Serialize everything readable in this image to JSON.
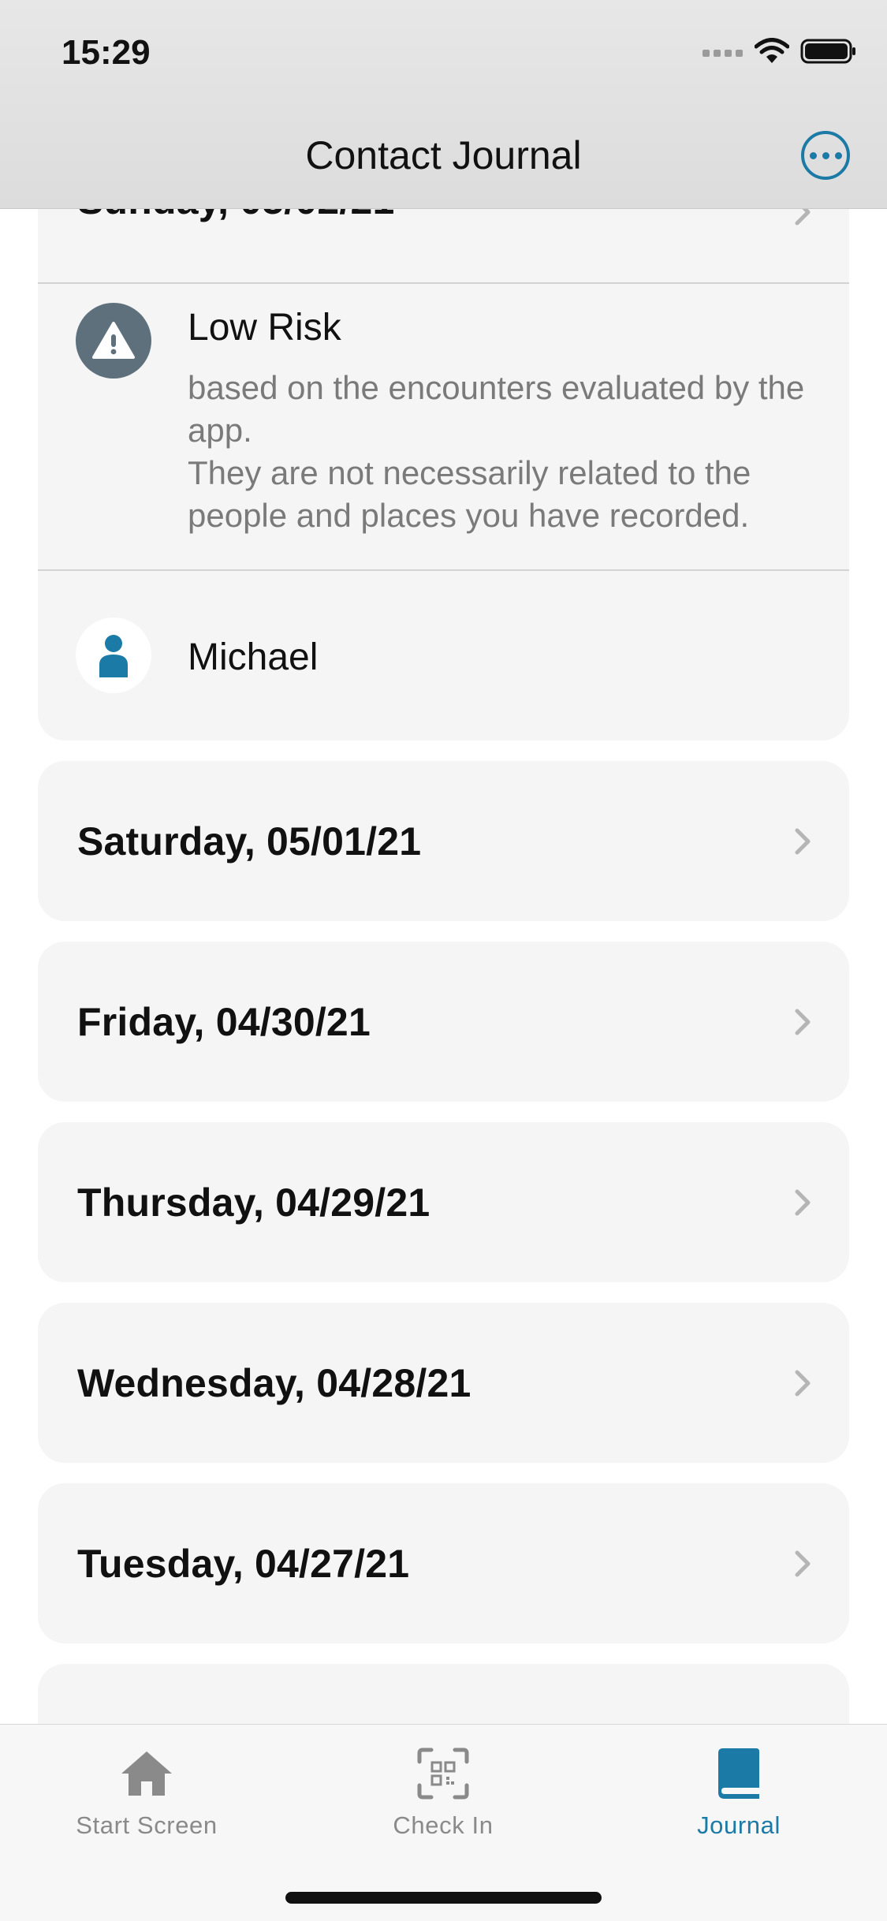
{
  "status_bar": {
    "time": "15:29"
  },
  "navigation": {
    "title": "Contact Journal",
    "more_icon": "ellipsis-circle-icon"
  },
  "colors": {
    "accent": "#1b7aa6",
    "risk_icon_bg": "#5f707d",
    "card_bg": "#f5f5f5"
  },
  "expanded_day": {
    "title": "Sunday, 05/02/21",
    "risk": {
      "icon": "warning-triangle-icon",
      "title": "Low Risk",
      "description_line1": "based on the encounters evaluated by the app.",
      "description_line2": "They are not necessarily related to the people and places you have recorded."
    },
    "person": {
      "icon": "person-icon",
      "name": "Michael"
    }
  },
  "days": [
    {
      "title": "Saturday, 05/01/21"
    },
    {
      "title": "Friday, 04/30/21"
    },
    {
      "title": "Thursday, 04/29/21"
    },
    {
      "title": "Wednesday, 04/28/21"
    },
    {
      "title": "Tuesday, 04/27/21"
    }
  ],
  "tabs": [
    {
      "label": "Start Screen",
      "icon": "house-icon",
      "active": false
    },
    {
      "label": "Check In",
      "icon": "qr-code-scanner-icon",
      "active": false
    },
    {
      "label": "Journal",
      "icon": "book-icon",
      "active": true
    }
  ]
}
